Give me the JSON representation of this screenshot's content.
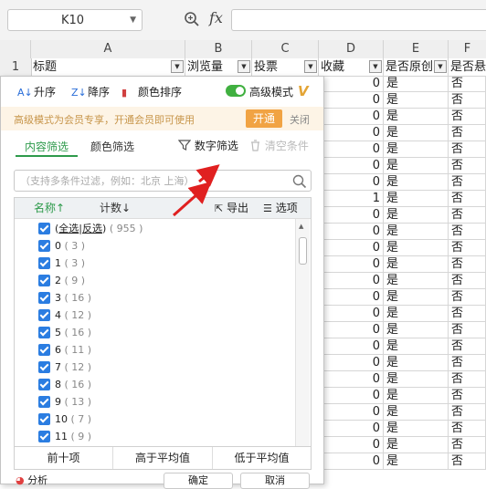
{
  "formula_bar": {
    "cell_ref": "K10",
    "fx": "fx",
    "formula": ""
  },
  "columns": [
    "A",
    "B",
    "C",
    "D",
    "E",
    "F"
  ],
  "header_row": {
    "row_number": "1",
    "cells": [
      "标题",
      "浏览量",
      "投票",
      "收藏",
      "是否原创",
      "是否悬"
    ]
  },
  "data_rows": [
    {
      "d": "0",
      "e": "是",
      "f": "否"
    },
    {
      "d": "0",
      "e": "是",
      "f": "否"
    },
    {
      "d": "0",
      "e": "是",
      "f": "否"
    },
    {
      "d": "0",
      "e": "是",
      "f": "否"
    },
    {
      "d": "0",
      "e": "是",
      "f": "否"
    },
    {
      "d": "0",
      "e": "是",
      "f": "否"
    },
    {
      "d": "0",
      "e": "是",
      "f": "否"
    },
    {
      "d": "1",
      "e": "是",
      "f": "否"
    },
    {
      "d": "0",
      "e": "是",
      "f": "否"
    },
    {
      "d": "0",
      "e": "是",
      "f": "否"
    },
    {
      "d": "0",
      "e": "是",
      "f": "否"
    },
    {
      "d": "0",
      "e": "是",
      "f": "否"
    },
    {
      "d": "0",
      "e": "是",
      "f": "否"
    },
    {
      "d": "0",
      "e": "是",
      "f": "否"
    },
    {
      "d": "0",
      "e": "是",
      "f": "否"
    },
    {
      "d": "0",
      "e": "是",
      "f": "否"
    },
    {
      "d": "0",
      "e": "是",
      "f": "否"
    },
    {
      "d": "0",
      "e": "是",
      "f": "否"
    },
    {
      "d": "0",
      "e": "是",
      "f": "否"
    },
    {
      "d": "0",
      "e": "是",
      "f": "否"
    },
    {
      "d": "0",
      "e": "是",
      "f": "否"
    },
    {
      "d": "0",
      "e": "是",
      "f": "否"
    },
    {
      "d": "0",
      "e": "是",
      "f": "否"
    },
    {
      "d": "0",
      "e": "是",
      "f": "否"
    }
  ],
  "filter_panel": {
    "sort": {
      "asc": "升序",
      "desc": "降序",
      "color": "颜色排序"
    },
    "advanced_mode": "高级模式",
    "advanced_on": true,
    "vip_banner": {
      "text": "高级模式为会员专享，开通会员即可使用",
      "open": "开通",
      "close": "关闭"
    },
    "tabs": {
      "content": "内容筛选",
      "color": "颜色筛选"
    },
    "number_filter": "数字筛选",
    "clear_conditions": "清空条件",
    "search_placeholder": "（支持多条件过滤，例如：北京 上海）",
    "list_header": {
      "name": "名称↑",
      "count": "计数↓",
      "export": "导出",
      "options": "选项"
    },
    "select_all": {
      "all": "全选",
      "invert": "反选",
      "count": "( 955 )"
    },
    "items": [
      {
        "label": "0",
        "count": "( 3 )"
      },
      {
        "label": "1",
        "count": "( 3 )"
      },
      {
        "label": "2",
        "count": "( 9 )"
      },
      {
        "label": "3",
        "count": "( 16 )"
      },
      {
        "label": "4",
        "count": "( 12 )"
      },
      {
        "label": "5",
        "count": "( 16 )"
      },
      {
        "label": "6",
        "count": "( 11 )"
      },
      {
        "label": "7",
        "count": "( 12 )"
      },
      {
        "label": "8",
        "count": "( 16 )"
      },
      {
        "label": "9",
        "count": "( 13 )"
      },
      {
        "label": "10",
        "count": "( 7 )"
      },
      {
        "label": "11",
        "count": "( 9 )"
      }
    ],
    "quick_buttons": [
      "前十项",
      "高于平均值",
      "低于平均值"
    ],
    "analysis": "分析",
    "ok": "确定",
    "cancel": "取消"
  },
  "colors": {
    "accent_green": "#2d9a4b",
    "checkbox_blue": "#2b7de1",
    "vip_orange": "#f1a343",
    "arrow_red": "#e02020"
  }
}
